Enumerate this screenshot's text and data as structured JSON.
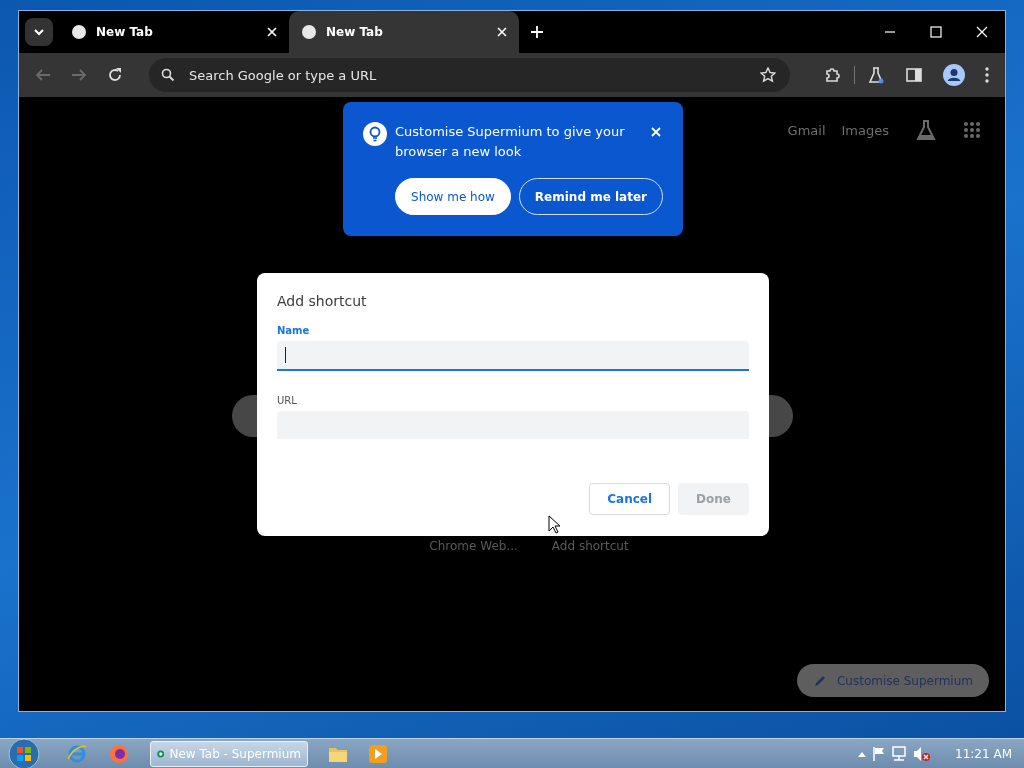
{
  "tabs": [
    {
      "title": "New Tab",
      "selected": false
    },
    {
      "title": "New Tab",
      "selected": true
    }
  ],
  "address_bar": {
    "placeholder": "Search Google or type a URL"
  },
  "top_links": [
    "Gmail",
    "Images"
  ],
  "promo": {
    "message": "Customise Supermium to give your browser a new look",
    "buttons": [
      {
        "label": "Show me how",
        "kind": "primary"
      },
      {
        "label": "Remind me later",
        "kind": "outline"
      }
    ]
  },
  "shortcuts": [
    {
      "title": "Chrome Web..."
    },
    {
      "title": "Add shortcut"
    }
  ],
  "dialog": {
    "title": "Add shortcut",
    "fields": [
      {
        "label": "Name",
        "focused": true
      },
      {
        "label": "URL",
        "focused": false
      }
    ],
    "buttons": [
      {
        "label": "Cancel",
        "disabled": false
      },
      {
        "label": "Done",
        "disabled": true
      }
    ]
  },
  "customise_button": "Customise Supermium",
  "taskbar": {
    "items": [
      {
        "kind": "ie"
      },
      {
        "kind": "firefox"
      },
      {
        "kind": "window",
        "label": "New Tab - Supermium",
        "selected": true
      },
      {
        "kind": "folder"
      },
      {
        "kind": "media"
      }
    ],
    "clock": "11:21 AM"
  }
}
